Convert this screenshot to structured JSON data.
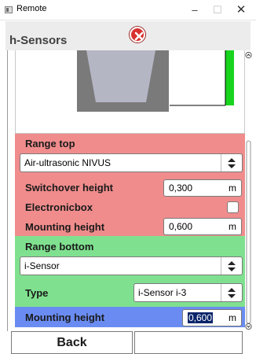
{
  "window": {
    "title": "Remote"
  },
  "header": {
    "title": "h-Sensors"
  },
  "range_top": {
    "title": "Range top",
    "sensor_select": "Air-ultrasonic NIVUS",
    "switchover_height": {
      "label": "Switchover height",
      "value": "0,300",
      "unit": "m"
    },
    "electronicbox": {
      "label": "Electronicbox",
      "checked": false
    },
    "mounting_height": {
      "label": "Mounting height",
      "value": "0,600",
      "unit": "m"
    }
  },
  "range_bottom": {
    "title": "Range bottom",
    "sensor_select": "i-Sensor",
    "type": {
      "label": "Type",
      "value": "i-Sensor i-3"
    },
    "mounting_height": {
      "label": "Mounting height",
      "value": "0,600",
      "unit": "m"
    }
  },
  "buttons": {
    "back_label": "Back",
    "second_label": ""
  },
  "colors": {
    "range_top_bg": "#f08c8c",
    "range_bottom_bg": "#7fe18f",
    "selected_row_bg": "#6a8cf2",
    "close_icon": "#d7312f",
    "level_bar": "#19d41f"
  }
}
